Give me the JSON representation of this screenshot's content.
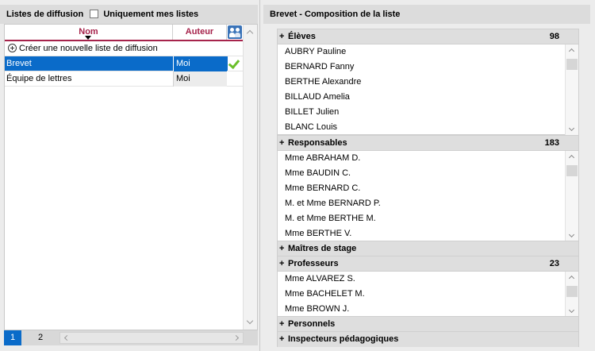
{
  "left_panel": {
    "title": "Listes de diffusion",
    "filter_label": "Uniquement mes listes",
    "columns": {
      "nom": "Nom",
      "auteur": "Auteur"
    },
    "create_label": "Créer une nouvelle liste de diffusion",
    "rows": [
      {
        "nom": "Brevet",
        "auteur": "Moi",
        "selected": true
      },
      {
        "nom": "Équipe de lettres",
        "auteur": "Moi",
        "selected": false
      }
    ],
    "pages": [
      "1",
      "2"
    ]
  },
  "right_panel": {
    "title": "Brevet - Composition de la liste",
    "sections": [
      {
        "label": "Élèves",
        "count": "98",
        "items": [
          "AUBRY Pauline",
          "BERNARD Fanny",
          "BERTHE Alexandre",
          "BILLAUD Amelia",
          "BILLET Julien",
          "BLANC Louis"
        ]
      },
      {
        "label": "Responsables",
        "count": "183",
        "items": [
          "Mme ABRAHAM D.",
          "Mme BAUDIN C.",
          "Mme BERNARD C.",
          "M. et Mme BERNARD P.",
          "M. et Mme BERTHE M.",
          "Mme BERTHE V."
        ]
      },
      {
        "label": "Maîtres de stage",
        "count": "",
        "items": []
      },
      {
        "label": "Professeurs",
        "count": "23",
        "items": [
          "Mme ALVAREZ S.",
          "Mme BACHELET M.",
          "Mme BROWN J."
        ]
      },
      {
        "label": "Personnels",
        "count": "",
        "items": []
      },
      {
        "label": "Inspecteurs pédagogiques",
        "count": "",
        "items": []
      }
    ]
  },
  "colors": {
    "accent": "#a6234b",
    "selection": "#0a6bc9",
    "check": "#6bbf2a"
  },
  "icons": {
    "expand": "plus-icon",
    "add": "plus-circle-icon",
    "owner_filter": "users-icon",
    "selected_flag": "check-icon"
  }
}
